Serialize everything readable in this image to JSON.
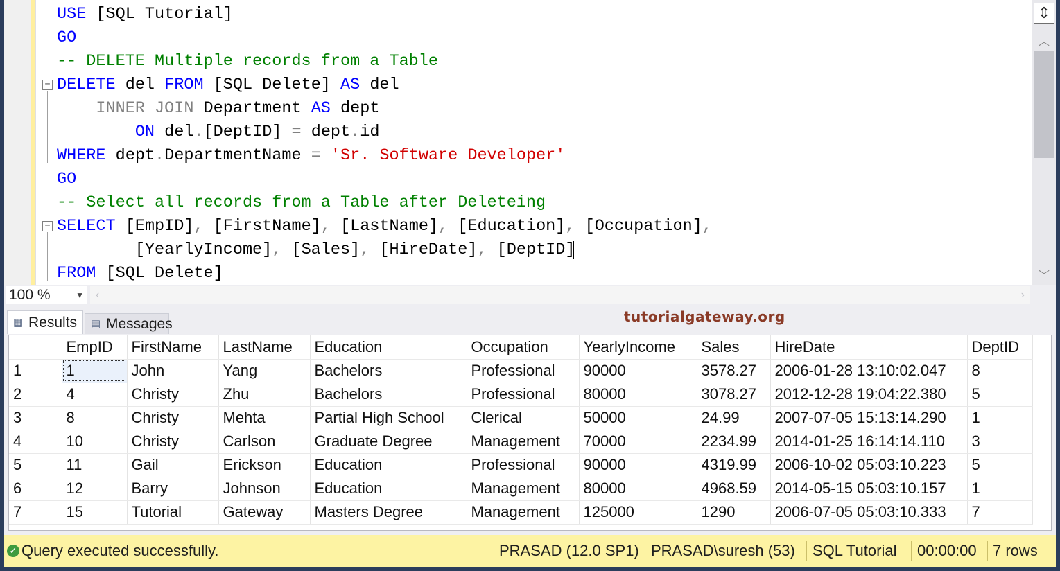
{
  "editor": {
    "lines": [
      {
        "segments": [
          {
            "t": "USE",
            "c": "kw"
          },
          {
            "t": " [SQL Tutorial]",
            "c": ""
          }
        ]
      },
      {
        "segments": [
          {
            "t": "GO",
            "c": "kw"
          }
        ]
      },
      {
        "segments": [
          {
            "t": "-- DELETE Multiple records from a Table",
            "c": "cm"
          }
        ]
      },
      {
        "segments": [
          {
            "t": "DELETE",
            "c": "kw"
          },
          {
            "t": " del ",
            "c": ""
          },
          {
            "t": "FROM",
            "c": "kw"
          },
          {
            "t": " [SQL Delete] ",
            "c": ""
          },
          {
            "t": "AS",
            "c": "kw"
          },
          {
            "t": " del",
            "c": ""
          }
        ]
      },
      {
        "segments": [
          {
            "t": "    ",
            "c": ""
          },
          {
            "t": "INNER JOIN",
            "c": "gr"
          },
          {
            "t": " Department ",
            "c": ""
          },
          {
            "t": "AS",
            "c": "kw"
          },
          {
            "t": " dept",
            "c": ""
          }
        ]
      },
      {
        "segments": [
          {
            "t": "        ",
            "c": ""
          },
          {
            "t": "ON",
            "c": "kw"
          },
          {
            "t": " del",
            "c": ""
          },
          {
            "t": ".",
            "c": "gr"
          },
          {
            "t": "[DeptID] ",
            "c": ""
          },
          {
            "t": "=",
            "c": "gr"
          },
          {
            "t": " dept",
            "c": ""
          },
          {
            "t": ".",
            "c": "gr"
          },
          {
            "t": "id",
            "c": ""
          }
        ]
      },
      {
        "segments": [
          {
            "t": "WHERE",
            "c": "kw"
          },
          {
            "t": " dept",
            "c": ""
          },
          {
            "t": ".",
            "c": "gr"
          },
          {
            "t": "DepartmentName ",
            "c": ""
          },
          {
            "t": "=",
            "c": "gr"
          },
          {
            "t": " ",
            "c": ""
          },
          {
            "t": "'Sr. Software Developer'",
            "c": "st"
          }
        ]
      },
      {
        "segments": [
          {
            "t": "GO",
            "c": "kw"
          }
        ]
      },
      {
        "segments": [
          {
            "t": "-- Select all records from a Table after Deleteing",
            "c": "cm"
          }
        ]
      },
      {
        "segments": [
          {
            "t": "SELECT",
            "c": "kw"
          },
          {
            "t": " [EmpID]",
            "c": ""
          },
          {
            "t": ",",
            "c": "gr"
          },
          {
            "t": " [FirstName]",
            "c": ""
          },
          {
            "t": ",",
            "c": "gr"
          },
          {
            "t": " [LastName]",
            "c": ""
          },
          {
            "t": ",",
            "c": "gr"
          },
          {
            "t": " [Education]",
            "c": ""
          },
          {
            "t": ",",
            "c": "gr"
          },
          {
            "t": " [Occupation]",
            "c": ""
          },
          {
            "t": ",",
            "c": "gr"
          }
        ]
      },
      {
        "segments": [
          {
            "t": "        [YearlyIncome]",
            "c": ""
          },
          {
            "t": ",",
            "c": "gr"
          },
          {
            "t": " [Sales]",
            "c": ""
          },
          {
            "t": ",",
            "c": "gr"
          },
          {
            "t": " [HireDate]",
            "c": ""
          },
          {
            "t": ",",
            "c": "gr"
          },
          {
            "t": " [DeptID]",
            "c": ""
          }
        ]
      },
      {
        "segments": [
          {
            "t": "FROM",
            "c": "kw"
          },
          {
            "t": " [SQL Delete]",
            "c": ""
          }
        ]
      }
    ]
  },
  "zoom": {
    "value": "100 %"
  },
  "tabs": {
    "results": "Results",
    "messages": "Messages"
  },
  "brand": "tutorialgateway.org",
  "results": {
    "columns": [
      "",
      "EmpID",
      "FirstName",
      "LastName",
      "Education",
      "Occupation",
      "YearlyIncome",
      "Sales",
      "HireDate",
      "DeptID"
    ],
    "rows": [
      [
        "1",
        "1",
        "John",
        "Yang",
        "Bachelors",
        "Professional",
        "90000",
        "3578.27",
        "2006-01-28 13:10:02.047",
        "8"
      ],
      [
        "2",
        "4",
        "Christy",
        "Zhu",
        "Bachelors",
        "Professional",
        "80000",
        "3078.27",
        "2012-12-28 19:04:22.380",
        "5"
      ],
      [
        "3",
        "8",
        "Christy",
        "Mehta",
        "Partial High School",
        "Clerical",
        "50000",
        "24.99",
        "2007-07-05 15:13:14.290",
        "1"
      ],
      [
        "4",
        "10",
        "Christy",
        "Carlson",
        "Graduate Degree",
        "Management",
        "70000",
        "2234.99",
        "2014-01-25 16:14:14.110",
        "3"
      ],
      [
        "5",
        "11",
        "Gail",
        "Erickson",
        "Education",
        "Professional",
        "90000",
        "4319.99",
        "2006-10-02 05:03:10.223",
        "5"
      ],
      [
        "6",
        "12",
        "Barry",
        "Johnson",
        "Education",
        "Management",
        "80000",
        "4968.59",
        "2014-05-15 05:03:10.157",
        "1"
      ],
      [
        "7",
        "15",
        "Tutorial",
        "Gateway",
        "Masters Degree",
        "Management",
        "125000",
        "1290",
        "2006-07-05 05:03:10.333",
        "7"
      ]
    ]
  },
  "status": {
    "message": "Query executed successfully.",
    "server": "PRASAD (12.0 SP1)",
    "user": "PRASAD\\suresh (53)",
    "database": "SQL Tutorial",
    "elapsed": "00:00:00",
    "rows": "7 rows"
  },
  "colors": {
    "keyword": "#0000ff",
    "comment": "#008000",
    "string": "#d10000",
    "status_bg": "#fdf3a3"
  }
}
